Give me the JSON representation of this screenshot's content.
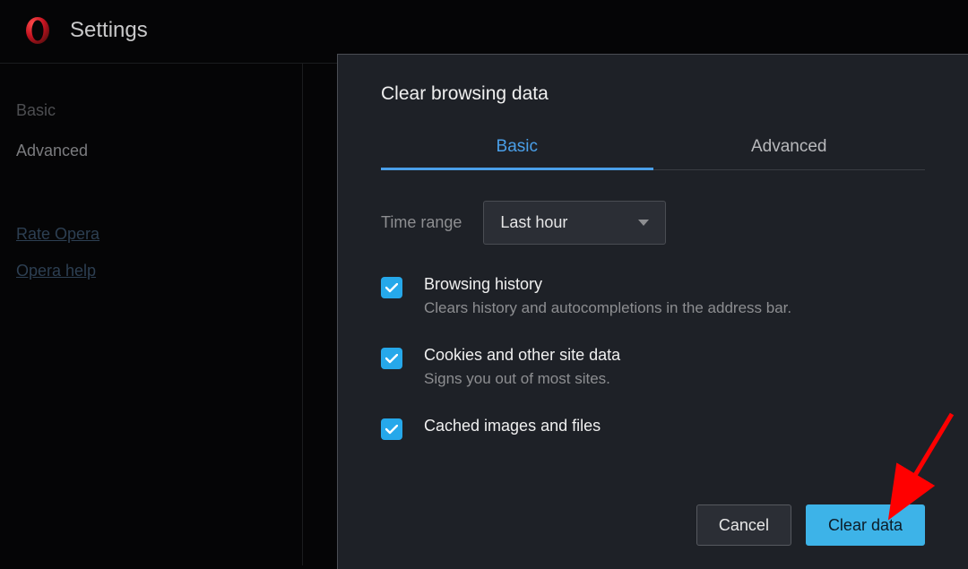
{
  "header": {
    "title": "Settings"
  },
  "sidebar": {
    "items": [
      {
        "label": "Basic"
      },
      {
        "label": "Advanced"
      }
    ],
    "links": [
      {
        "label": "Rate Opera"
      },
      {
        "label": "Opera help"
      }
    ]
  },
  "dialog": {
    "title": "Clear browsing data",
    "tabs": [
      {
        "label": "Basic",
        "active": true
      },
      {
        "label": "Advanced",
        "active": false
      }
    ],
    "time_range": {
      "label": "Time range",
      "value": "Last hour"
    },
    "options": [
      {
        "checked": true,
        "title": "Browsing history",
        "desc": "Clears history and autocompletions in the address bar."
      },
      {
        "checked": true,
        "title": "Cookies and other site data",
        "desc": "Signs you out of most sites."
      },
      {
        "checked": true,
        "title": "Cached images and files",
        "desc": ""
      }
    ],
    "buttons": {
      "cancel": "Cancel",
      "confirm": "Clear data"
    }
  },
  "colors": {
    "accent": "#3db3e8",
    "ink_accent": "#4a9fe8"
  }
}
